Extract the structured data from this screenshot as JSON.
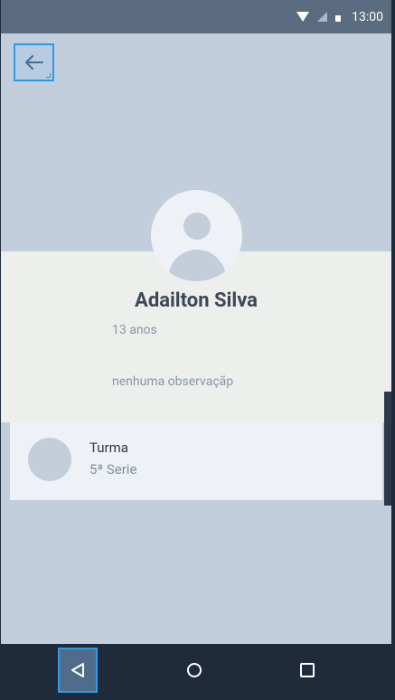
{
  "status_bar": {
    "time": "13:00",
    "icons": [
      "wifi-icon",
      "cell-signal-icon",
      "battery-icon"
    ]
  },
  "header": {
    "back_icon": "arrow-left-icon"
  },
  "profile": {
    "avatar_icon": "user-avatar-icon",
    "name": "Adailton Silva",
    "age": "13 anos",
    "observation": "nenhuma observaçãp"
  },
  "class_info": {
    "label": "Turma",
    "value": "5ª Serie"
  },
  "nav_bar": {
    "items": [
      "nav-back-icon",
      "nav-home-icon",
      "nav-recents-icon"
    ]
  },
  "colors": {
    "background": "#c3cedd",
    "status_bar": "#5c6c80",
    "card": "#edefec",
    "accent_focus": "#2d9bea",
    "nav_bar": "#1f2b3b"
  }
}
